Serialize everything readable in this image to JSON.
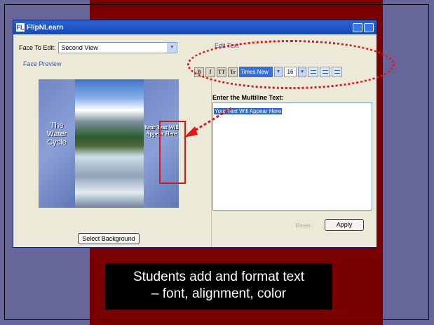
{
  "window": {
    "title": "FlipNLearn",
    "logo_text": "FL"
  },
  "face": {
    "label": "Face To Edit:",
    "selected": "Second View"
  },
  "preview": {
    "label": "Face Preview",
    "left_panel_text": "The Water Cycle",
    "right_panel_text": "Your Text Will Appear Here",
    "select_background_label": "Select Background"
  },
  "edit": {
    "label": "Edit Text",
    "toolbar": {
      "bold": "B",
      "italic": "I",
      "caps": "TT",
      "small_caps": "Tr",
      "font": "Times New",
      "size": "16"
    },
    "enter_label": "Enter the Multiline Text:",
    "text_value": "Your Text Will Appear Here",
    "reset_label": "Reset",
    "apply_label": "Apply"
  },
  "caption": {
    "line1": "Students add and format text",
    "line2": "– font, alignment, color"
  },
  "colors": {
    "slide_bg": "#66669a",
    "maroon": "#7a0000",
    "annotation_red": "#e01818",
    "selection_blue": "#316ac5"
  }
}
